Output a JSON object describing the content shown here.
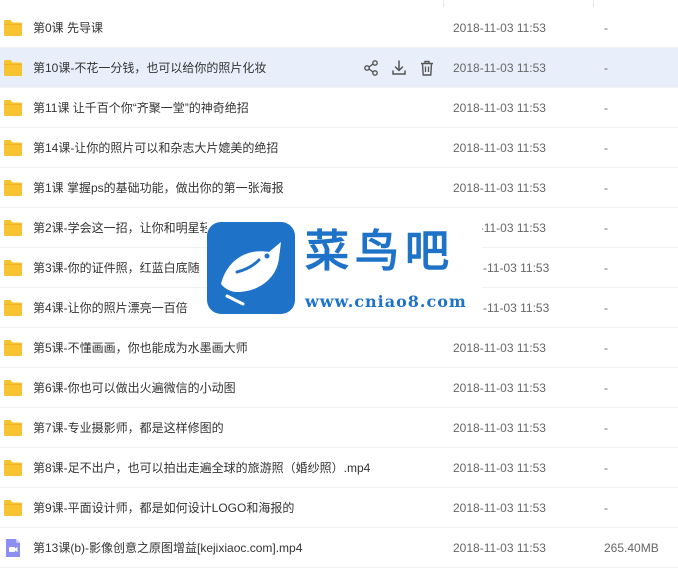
{
  "colors": {
    "folder": "#f7c331",
    "folder_tab": "#f2b11e",
    "video_icon": "#8c8ef2",
    "hover_row": "#e9eefb",
    "watermark_blue": "#1e73c8"
  },
  "files": [
    {
      "name": "第0课 先导课",
      "date": "2018-11-03 11:53",
      "size": "-",
      "type": "folder",
      "icon": "folder-icon"
    },
    {
      "name": "第10课-不花一分钱，也可以给你的照片化妆",
      "date": "2018-11-03 11:53",
      "size": "-",
      "type": "folder",
      "icon": "folder-icon",
      "hovered": true
    },
    {
      "name": "第11课 让千百个你“齐聚一堂”的神奇绝招",
      "date": "2018-11-03 11:53",
      "size": "-",
      "type": "folder",
      "icon": "folder-icon"
    },
    {
      "name": "第14课-让你的照片可以和杂志大片媲美的绝招",
      "date": "2018-11-03 11:53",
      "size": "-",
      "type": "folder",
      "icon": "folder-icon"
    },
    {
      "name": "第1课 掌握ps的基础功能，做出你的第一张海报",
      "date": "2018-11-03 11:53",
      "size": "-",
      "type": "folder",
      "icon": "folder-icon"
    },
    {
      "name": "第2课-学会这一招，让你和明星轻松“合影”",
      "date": "2018-11-03 11:53",
      "size": "-",
      "type": "folder",
      "icon": "folder-icon"
    },
    {
      "name": "第3课-你的证件照，红蓝白底随",
      "date": "-11-03 11:53",
      "size": "-",
      "type": "folder",
      "icon": "folder-icon"
    },
    {
      "name": "第4课-让你的照片漂亮一百倍",
      "date": "-11-03 11:53",
      "size": "-",
      "type": "folder",
      "icon": "folder-icon"
    },
    {
      "name": "第5课-不懂画画，你也能成为水墨画大师",
      "date": "2018-11-03 11:53",
      "size": "-",
      "type": "folder",
      "icon": "folder-icon"
    },
    {
      "name": "第6课-你也可以做出火遍微信的小动图",
      "date": "2018-11-03 11:53",
      "size": "-",
      "type": "folder",
      "icon": "folder-icon"
    },
    {
      "name": "第7课-专业摄影师，都是这样修图的",
      "date": "2018-11-03 11:53",
      "size": "-",
      "type": "folder",
      "icon": "folder-icon"
    },
    {
      "name": "第8课-足不出户，也可以拍出走遍全球的旅游照（婚纱照）.mp4",
      "date": "2018-11-03 11:53",
      "size": "-",
      "type": "folder",
      "icon": "folder-icon"
    },
    {
      "name": "第9课-平面设计师，都是如何设计LOGO和海报的",
      "date": "2018-11-03 11:53",
      "size": "-",
      "type": "folder",
      "icon": "folder-icon"
    },
    {
      "name": "第13课(b)-影像创意之原图增益[kejixiaoc.com].mp4",
      "date": "2018-11-03 11:53",
      "size": "265.40MB",
      "type": "video",
      "icon": "video-file-icon"
    }
  ],
  "row_actions": {
    "share": "share-icon",
    "download": "download-icon",
    "delete": "trash-icon"
  },
  "watermark": {
    "title": "菜鸟吧",
    "url": "www.cniao8.com",
    "logo": "bird-logo-icon"
  }
}
